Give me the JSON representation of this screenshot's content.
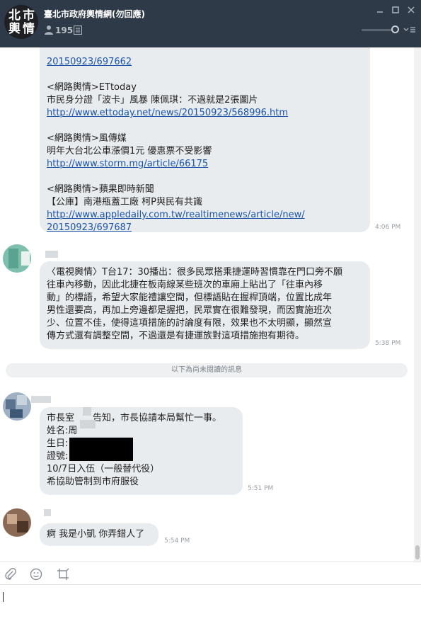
{
  "header": {
    "avatar_chars": [
      "北",
      "市",
      "輿",
      "情"
    ],
    "title": "臺北市政府輿情網(勿回應)",
    "member_count": "195",
    "icons": [
      "member-icon",
      "notes-icon",
      "minimize-icon",
      "maximize-icon",
      "close-icon",
      "volume-slider",
      "menu-caret-icon"
    ]
  },
  "messages": {
    "m1": {
      "lines": [
        {
          "text": "20150923/697662",
          "link": true
        },
        {
          "text": "",
          "link": false
        },
        {
          "text": "<網路輿情>ETtoday",
          "link": false
        },
        {
          "text": "市民身分證「波卡」風暴 陳佩琪：不過就是2張圖片",
          "link": false
        },
        {
          "text": "http://www.ettoday.net/news/20150923/568996.htm",
          "link": true
        },
        {
          "text": "",
          "link": false
        },
        {
          "text": "<網路輿情>風傳媒",
          "link": false
        },
        {
          "text": "明年大台北公車漲價1元 優惠票不受影響",
          "link": false
        },
        {
          "text": "http://www.storm.mg/article/66175",
          "link": true
        },
        {
          "text": "",
          "link": false
        },
        {
          "text": "<網路輿情>蘋果即時新聞",
          "link": false
        },
        {
          "text": "【公庫】南港瓶蓋工廠 柯P與民有共識",
          "link": false
        },
        {
          "text": "http://www.appledaily.com.tw/realtimenews/article/new/",
          "link": true
        },
        {
          "text": "20150923/697687",
          "link": true
        }
      ],
      "time": "4:06 PM"
    },
    "m2": {
      "lines": [
        "〈電視輿情〉T台17：30播出：很多民眾搭乘捷運時習慣靠在門口旁不願",
        "往車內移動，因此北捷在板南線某些班次的車廂上貼出了「往車內移",
        "動」的標語，希望大家能禮讓空間，但標語貼在握桿頂端，位置比成年",
        "男性還要高，再加上旁邊都是握把，民眾實在很難發現，而因實施班次",
        "少、位置不佳，使得這項措施的討論度有限，效果也不太明顯，顯然宣",
        "傳方式還有調整空間，不過還是有捷運族對這項措施抱有期待。"
      ],
      "time": "5:38 PM"
    },
    "divider_label": "以下為尚未閱讀的訊息",
    "m3": {
      "lines": [
        "市長室　　告知，市長協請本局幫忙一事。",
        "姓名:周",
        "生日:",
        "證號:",
        "10/7日入伍（一般替代役）",
        "希協助管制到市府服役"
      ],
      "time": "5:51 PM"
    },
    "m4": {
      "text": "痾 我是小凱 你弄錯人了",
      "time": "5:54 PM"
    }
  },
  "toolbar": {
    "icons": [
      "attach-icon",
      "emoji-icon",
      "crop-icon"
    ]
  },
  "colors": {
    "header_bg": "#2f3a48",
    "bubble_bg": "#e9ecef",
    "link": "#1a55a8"
  }
}
